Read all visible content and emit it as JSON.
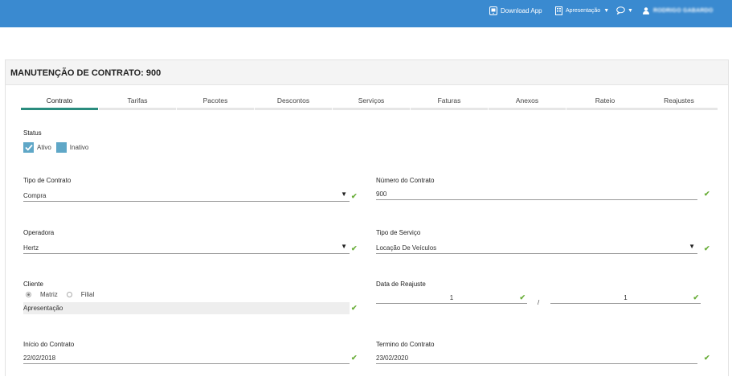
{
  "topbar": {
    "download_label": "Download App",
    "workspace_label": "Apresentação",
    "user_name": "RODRIGO GABARDO"
  },
  "page": {
    "title": "MANUTENÇÃO DE CONTRATO: 900"
  },
  "tabs": [
    {
      "label": "Contrato",
      "active": true
    },
    {
      "label": "Tarifas"
    },
    {
      "label": "Pacotes"
    },
    {
      "label": "Descontos"
    },
    {
      "label": "Serviços"
    },
    {
      "label": "Faturas"
    },
    {
      "label": "Anexos"
    },
    {
      "label": "Rateio"
    },
    {
      "label": "Reajustes"
    }
  ],
  "form": {
    "status": {
      "label": "Status",
      "options": [
        "Ativo",
        "Inativo"
      ],
      "checked": "Ativo"
    },
    "tipo_contrato": {
      "label": "Tipo de Contrato",
      "value": "Compra"
    },
    "numero_contrato": {
      "label": "Número do Contrato",
      "value": "900"
    },
    "operadora": {
      "label": "Operadora",
      "value": "Hertz"
    },
    "tipo_servico": {
      "label": "Tipo de Serviço",
      "value": "Locação De Veículos"
    },
    "cliente": {
      "label": "Cliente",
      "options": [
        "Matriz",
        "Filial"
      ],
      "selected": "Matriz",
      "value": "Apresentação"
    },
    "data_reajuste": {
      "label": "Data de Reajuste",
      "value1": "1",
      "separator": "/",
      "value2": "1"
    },
    "inicio": {
      "label": "Início do Contrato",
      "value": "22/02/2018"
    },
    "termino": {
      "label": "Termino do Contrato",
      "value": "23/02/2020"
    }
  },
  "colors": {
    "topbar": "#3a8ad0",
    "accent": "#2a8c7e",
    "check": "#6aae3a",
    "checkbox": "#5fa7c7"
  }
}
